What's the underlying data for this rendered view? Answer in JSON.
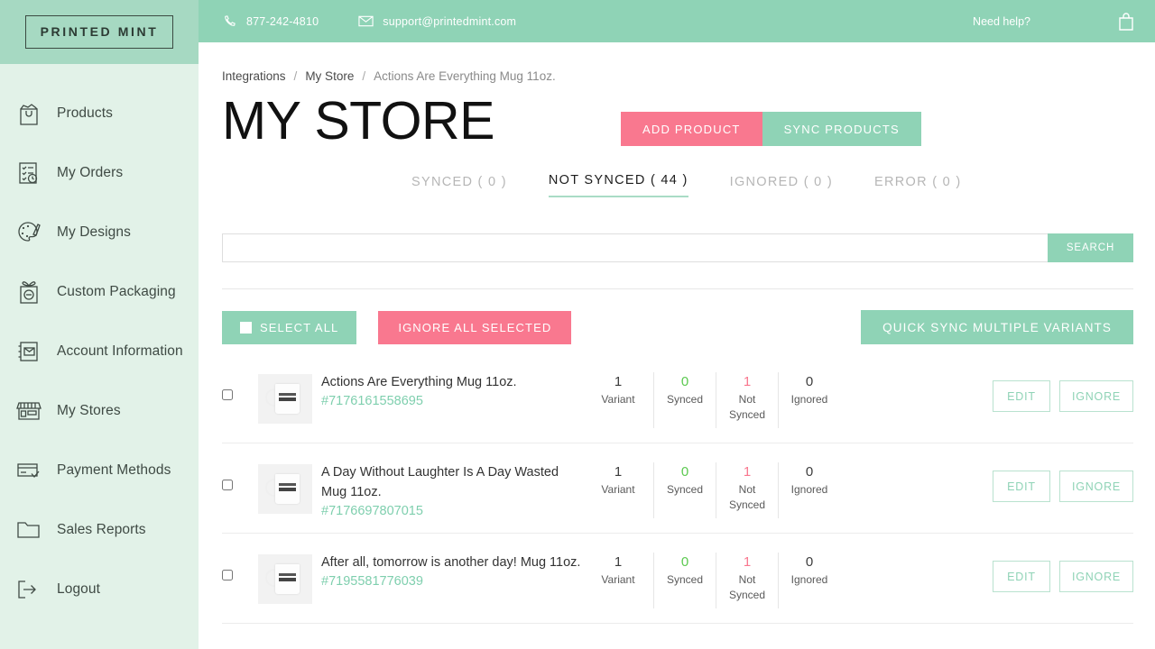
{
  "brand": {
    "logo_text": "PRINTED MINT"
  },
  "topbar": {
    "phone": "877-242-4810",
    "email": "support@printedmint.com",
    "need_help": "Need help?",
    "phone_icon": "phone-icon",
    "email_icon": "envelope-icon",
    "bag_icon": "shopping-bag-icon"
  },
  "sidebar": {
    "items": [
      {
        "label": "Products",
        "icon": "products-bag-icon"
      },
      {
        "label": "My Orders",
        "icon": "checklist-clock-icon"
      },
      {
        "label": "My Designs",
        "icon": "palette-brush-icon"
      },
      {
        "label": "Custom Packaging",
        "icon": "gift-box-icon"
      },
      {
        "label": "Account Information",
        "icon": "envelope-book-icon"
      },
      {
        "label": "My Stores",
        "icon": "storefront-icon"
      },
      {
        "label": "Payment Methods",
        "icon": "credit-card-check-icon"
      },
      {
        "label": "Sales Reports",
        "icon": "folder-icon"
      },
      {
        "label": "Logout",
        "icon": "logout-arrow-icon"
      }
    ]
  },
  "breadcrumb": {
    "items": [
      "Integrations",
      "My Store",
      "Actions Are Everything Mug 11oz."
    ],
    "separator": "/"
  },
  "header": {
    "title": "MY STORE",
    "add_product_label": "ADD PRODUCT",
    "sync_products_label": "SYNC PRODUCTS"
  },
  "tabs": [
    {
      "label": "SYNCED ( 0 )",
      "active": false
    },
    {
      "label": "NOT SYNCED ( 44  )",
      "active": true
    },
    {
      "label": "IGNORED ( 0 )",
      "active": false
    },
    {
      "label": "ERROR ( 0 )",
      "active": false
    }
  ],
  "search": {
    "value": "",
    "placeholder": "",
    "button_label": "SEARCH"
  },
  "bulk_actions": {
    "select_all_label": "SELECT ALL",
    "ignore_all_label": "IGNORE ALL SELECTED",
    "quick_sync_label": "QUICK SYNC MULTIPLE VARIANTS"
  },
  "row_actions": {
    "edit_label": "EDIT",
    "ignore_label": "IGNORE"
  },
  "stat_labels": {
    "variant": "Variant",
    "synced": "Synced",
    "not_synced": "Not Synced",
    "ignored": "Ignored"
  },
  "products": [
    {
      "name": "Actions Are Everything Mug 11oz.",
      "id": "#7176161558695",
      "variant_count": "1",
      "synced_count": "0",
      "not_synced_count": "1",
      "ignored_count": "0",
      "checked": false
    },
    {
      "name": "A Day Without Laughter Is A Day Wasted Mug 11oz.",
      "id": "#7176697807015",
      "variant_count": "1",
      "synced_count": "0",
      "not_synced_count": "1",
      "ignored_count": "0",
      "checked": false
    },
    {
      "name": "After all, tomorrow is another day! Mug 11oz.",
      "id": "#7195581776039",
      "variant_count": "1",
      "synced_count": "0",
      "not_synced_count": "1",
      "ignored_count": "0",
      "checked": false
    }
  ],
  "colors": {
    "mint": "#8fd3b6",
    "mint_light": "#e2f2e8",
    "mint_band": "#a6d9c2",
    "pink": "#f9788f",
    "green_text": "#5bc94f",
    "id_green": "#7fcfae"
  }
}
